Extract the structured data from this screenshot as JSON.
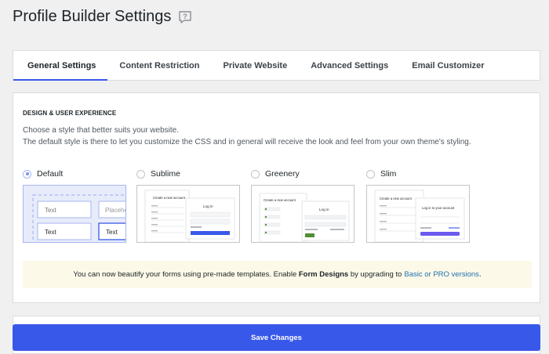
{
  "header": {
    "title": "Profile Builder Settings",
    "help_icon": "speech-bubble-question-icon"
  },
  "tabs": [
    {
      "label": "General Settings",
      "active": true
    },
    {
      "label": "Content Restriction",
      "active": false
    },
    {
      "label": "Private Website",
      "active": false
    },
    {
      "label": "Advanced Settings",
      "active": false
    },
    {
      "label": "Email Customizer",
      "active": false
    }
  ],
  "design": {
    "section_title": "DESIGN & USER EXPERIENCE",
    "description_line1": "Choose a style that better suits your website.",
    "description_line2": "The default style is there to let you customize the CSS and in general will receive the look and feel from your own theme's styling.",
    "options": [
      {
        "label": "Default",
        "selected": true,
        "preview": {
          "field1": "Text",
          "field2": "Placeho",
          "field3": "Text",
          "field4": "Text"
        }
      },
      {
        "label": "Sublime",
        "selected": false,
        "preview": {
          "left_title": "Create a new account",
          "right_title": "Log in"
        }
      },
      {
        "label": "Greenery",
        "selected": false,
        "preview": {
          "left_title": "Create a new account",
          "right_title": "Log in"
        }
      },
      {
        "label": "Slim",
        "selected": false,
        "preview": {
          "left_title": "Create a new account",
          "right_title": "Log in to your account"
        }
      }
    ]
  },
  "notice": {
    "text_before": "You can now beautify your forms using pre-made templates. Enable",
    "bold_text": "Form Designs",
    "text_middle": "by upgrading to",
    "link_text": "Basic or PRO versions",
    "text_after": "."
  },
  "footer": {
    "save_label": "Save Changes"
  },
  "colors": {
    "accent": "#3858e9",
    "notice_bg": "#fcf9e8",
    "link": "#2271b1",
    "greenery": "#4f8f34"
  }
}
